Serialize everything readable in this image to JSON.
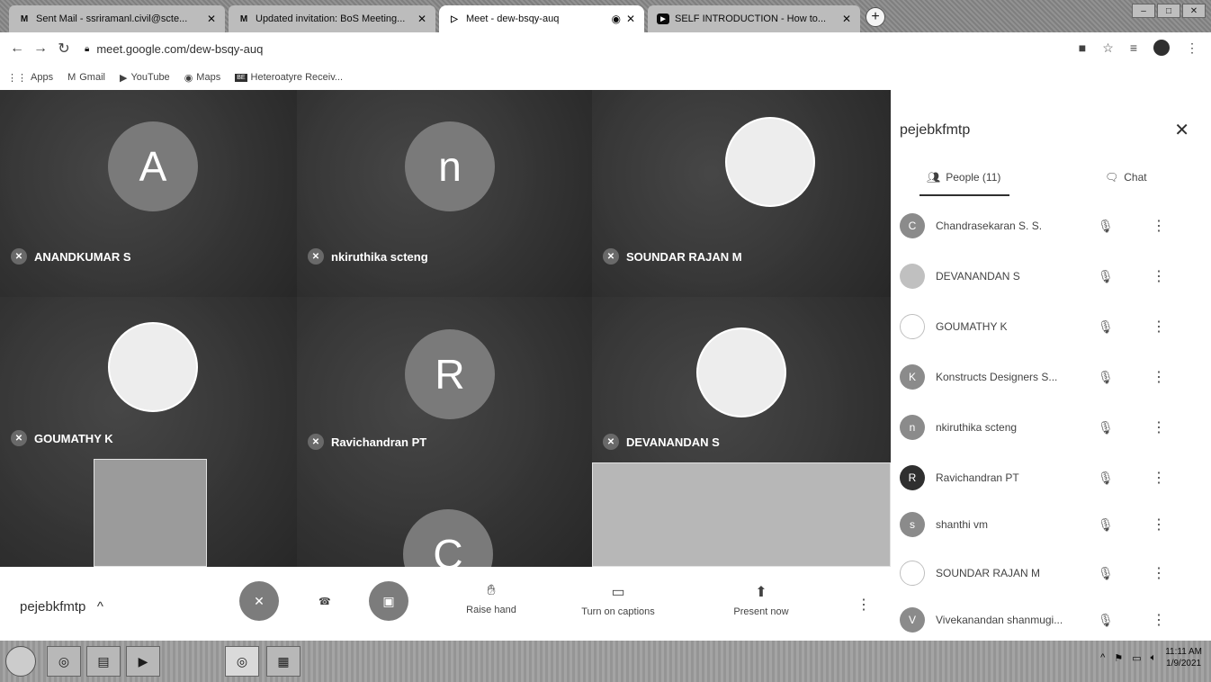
{
  "browser": {
    "tabs": [
      {
        "icon": "M",
        "title": "Sent Mail - ssriramanl.civil@scte..."
      },
      {
        "icon": "M",
        "title": "Updated invitation: BoS Meeting..."
      },
      {
        "icon": "▷",
        "title": "Meet - dew-bsqy-auq"
      },
      {
        "icon": "▶",
        "title": "SELF INTRODUCTION - How to..."
      }
    ],
    "url": "meet.google.com/dew-bsqy-auq",
    "bookmarks": [
      {
        "icon": "⋮⋮",
        "label": "Apps"
      },
      {
        "icon": "M",
        "label": "Gmail"
      },
      {
        "icon": "▶",
        "label": "YouTube"
      },
      {
        "icon": "◉",
        "label": "Maps"
      },
      {
        "icon": "BE",
        "label": "Heteroatyre Receiv..."
      }
    ]
  },
  "meeting": {
    "code": "pejebkfmtp",
    "tiles": [
      {
        "initial": "A",
        "name": "ANANDKUMAR S"
      },
      {
        "initial": "n",
        "name": "nkiruthika scteng"
      },
      {
        "initial": "",
        "name": "SOUNDAR RAJAN M"
      },
      {
        "initial": "",
        "name": "GOUMATHY K"
      },
      {
        "initial": "R",
        "name": "Ravichandran PT"
      },
      {
        "initial": "",
        "name": "DEVANANDAN S"
      },
      {
        "initial": "C",
        "name": ""
      }
    ],
    "controls": {
      "raise_hand": "Raise hand",
      "captions": "Turn on captions",
      "present": "Present now"
    }
  },
  "panel": {
    "title": "pejebkfmtp",
    "people_tab": "People (11)",
    "chat_tab": "Chat",
    "people": [
      {
        "initial": "C",
        "name": "Chandrasekaran S. S."
      },
      {
        "initial": "",
        "name": "DEVANANDAN S"
      },
      {
        "initial": "",
        "name": "GOUMATHY K"
      },
      {
        "initial": "K",
        "name": "Konstructs Designers S..."
      },
      {
        "initial": "n",
        "name": "nkiruthika scteng"
      },
      {
        "initial": "R",
        "name": "Ravichandran PT"
      },
      {
        "initial": "s",
        "name": "shanthi vm"
      },
      {
        "initial": "",
        "name": "SOUNDAR RAJAN M"
      },
      {
        "initial": "V",
        "name": "Vivekanandan shanmugi..."
      }
    ]
  },
  "taskbar": {
    "time": "11:11 AM",
    "date": "1/9/2021"
  }
}
